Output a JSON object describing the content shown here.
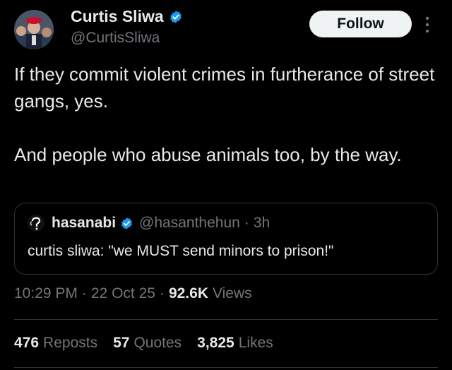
{
  "author": {
    "name": "Curtis Sliwa",
    "handle": "@CurtisSliwa",
    "verified_color": "#1d9bf0"
  },
  "follow_button": {
    "label": "Follow"
  },
  "tweet": {
    "paragraphs": [
      "If they commit violent crimes in furtherance of street gangs, yes.",
      "And people who abuse animals too, by the way."
    ]
  },
  "quote": {
    "name": "hasanabi",
    "handle": "@hasanthehun",
    "separator": "·",
    "time": "3h",
    "text": "curtis sliwa: \"we MUST send minors to prison!\""
  },
  "meta": {
    "time": "10:29 PM",
    "date": "22 Oct 25",
    "views_count": "92.6K",
    "views_label": "Views",
    "separator": "·"
  },
  "stats": {
    "reposts_count": "476",
    "reposts_label": "Reposts",
    "quotes_count": "57",
    "quotes_label": "Quotes",
    "likes_count": "3,825",
    "likes_label": "Likes"
  },
  "icons": {
    "avatar": "profile-photo",
    "verified": "verified-badge-icon",
    "more": "more-vertical-icon",
    "quote_avatar": "quote-profile-photo"
  }
}
